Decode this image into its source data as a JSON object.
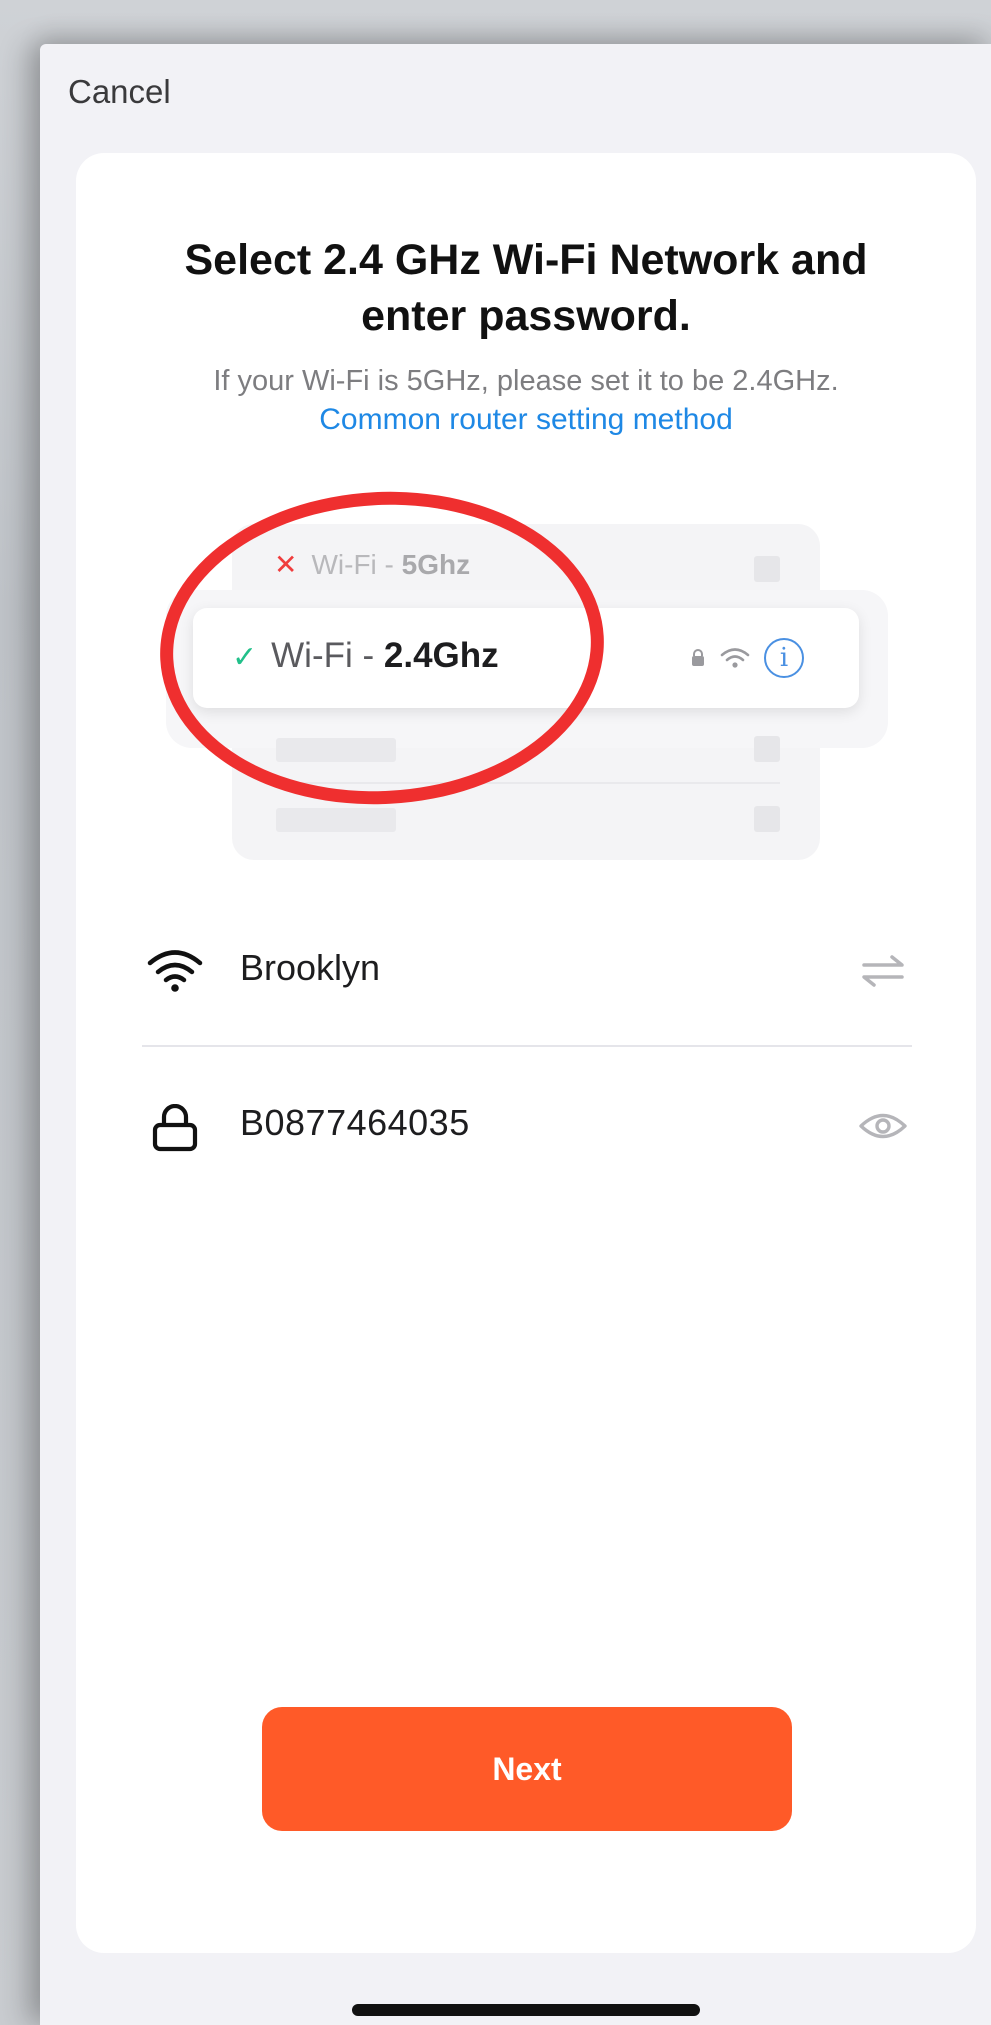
{
  "nav": {
    "cancel_label": "Cancel"
  },
  "header": {
    "title": "Select 2.4 GHz Wi-Fi Network and enter password.",
    "subtitle": "If your Wi-Fi is 5GHz, please set it to be 2.4GHz.",
    "router_link": "Common router setting method"
  },
  "illustration": {
    "row_5g": {
      "prefix": "Wi-Fi - ",
      "band": "5Ghz",
      "status_icon": "x-icon"
    },
    "row_24": {
      "prefix": "Wi-Fi - ",
      "band": "2.4Ghz",
      "status_icon": "check-icon",
      "info_glyph": "i"
    }
  },
  "form": {
    "ssid": {
      "value": "Brooklyn",
      "icon": "wifi-icon",
      "action_icon": "switch-network-icon"
    },
    "password": {
      "value": "B0877464035",
      "icon": "lock-icon",
      "action_icon": "eye-icon"
    }
  },
  "actions": {
    "next_label": "Next"
  },
  "colors": {
    "accent": "#ff5a28",
    "link": "#1e88e5",
    "highlight_circle": "#ef2f2f",
    "check": "#22c08a",
    "x_mark": "#f03d3d"
  }
}
